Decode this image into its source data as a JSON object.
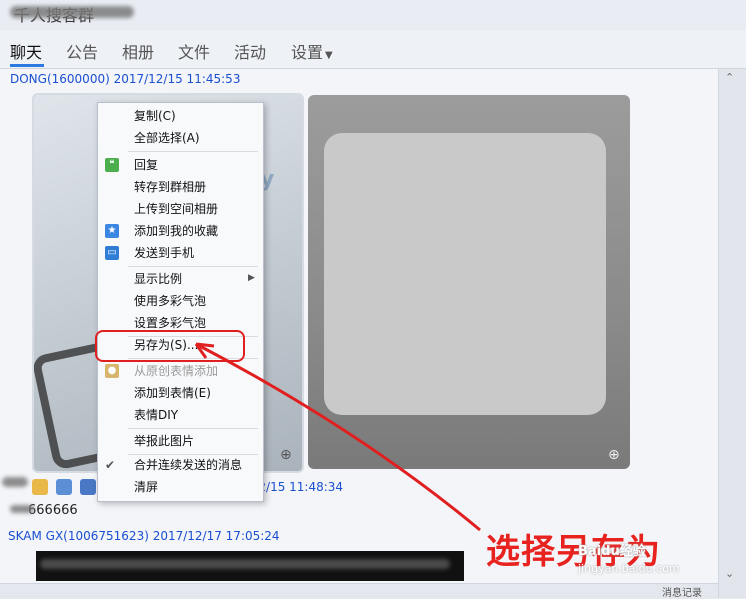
{
  "window": {
    "title": "千人搜客群"
  },
  "tabs": [
    {
      "label": "聊天"
    },
    {
      "label": "公告"
    },
    {
      "label": "相册"
    },
    {
      "label": "文件"
    },
    {
      "label": "活动"
    },
    {
      "label": "设置"
    }
  ],
  "messages": [
    {
      "meta": "DONG(1600000) 2017/12/15 11:45:53"
    },
    {
      "meta": "ChA(  ) 2017/12/15 11:48:34",
      "text": "666666"
    },
    {
      "meta": "SKAM GX(1006751623) 2017/12/17 17:05:24"
    }
  ],
  "context_menu": {
    "items": [
      {
        "label": "复制(C)"
      },
      {
        "label": "全部选择(A)"
      },
      {
        "label": "回复"
      },
      {
        "label": "转存到群相册"
      },
      {
        "label": "上传到空间相册"
      },
      {
        "label": "添加到我的收藏"
      },
      {
        "label": "发送到手机"
      },
      {
        "label": "显示比例"
      },
      {
        "label": "使用多彩气泡"
      },
      {
        "label": "设置多彩气泡"
      },
      {
        "label": "另存为(S)..."
      },
      {
        "label": "从原创表情添加"
      },
      {
        "label": "添加到表情(E)"
      },
      {
        "label": "表情DIY"
      },
      {
        "label": "举报此图片"
      },
      {
        "label": "合并连续发送的消息"
      },
      {
        "label": "清屏"
      }
    ]
  },
  "annotation": {
    "callout": "选择另存为"
  },
  "watermark": {
    "brand": "Baidu经验",
    "url": "jingyan.baidu.com"
  },
  "side": {
    "label": "消息记录"
  },
  "colors": {
    "accent": "#2a7ae2",
    "highlight": "#e02020",
    "link": "#1a4fd0"
  }
}
